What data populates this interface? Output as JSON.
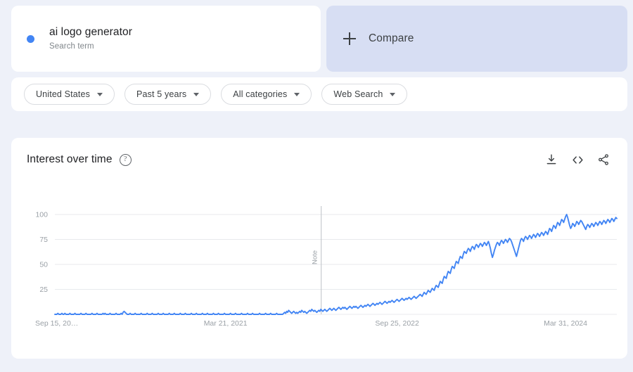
{
  "search_term": {
    "label": "ai logo generator",
    "type": "Search term",
    "color": "#4285f4"
  },
  "compare": {
    "label": "Compare",
    "icon": "plus-icon"
  },
  "filters": [
    {
      "label": "United States"
    },
    {
      "label": "Past 5 years"
    },
    {
      "label": "All categories"
    },
    {
      "label": "Web Search"
    }
  ],
  "chart_panel": {
    "title": "Interest over time",
    "help_glyph": "?",
    "actions": [
      {
        "name": "download-icon"
      },
      {
        "name": "embed-icon"
      },
      {
        "name": "share-icon"
      }
    ]
  },
  "chart_data": {
    "type": "line",
    "title": "Interest over time",
    "xlabel": "",
    "ylabel": "",
    "ylim": [
      0,
      100
    ],
    "yticks": [
      25,
      50,
      75,
      100
    ],
    "grid": true,
    "legend_position": "none",
    "line_color": "#4285f4",
    "x_tick_labels": [
      "Sep 15, 20…",
      "Mar 21, 2021",
      "Sep 25, 2022",
      "Mar 31, 2024"
    ],
    "x_tick_positions": [
      0,
      0.3,
      0.605,
      0.905
    ],
    "annotations": [
      {
        "label": "Note",
        "x_fraction": 0.474,
        "orientation": "vertical"
      }
    ],
    "series": [
      {
        "name": "ai logo generator",
        "values": [
          0,
          0,
          0,
          1,
          0,
          0,
          0,
          1,
          0,
          0,
          1,
          0,
          0,
          0,
          0,
          1,
          0,
          0,
          0,
          0,
          1,
          0,
          0,
          0,
          0,
          0,
          1,
          0,
          0,
          0,
          0,
          1,
          0,
          0,
          0,
          0,
          0,
          1,
          0,
          0,
          0,
          0,
          1,
          0,
          0,
          0,
          0,
          0,
          1,
          0,
          1,
          0,
          0,
          0,
          0,
          1,
          0,
          0,
          0,
          0,
          0,
          1,
          0,
          0,
          0,
          0,
          1,
          0,
          2,
          3,
          2,
          1,
          0,
          0,
          0,
          1,
          0,
          0,
          0,
          0,
          1,
          0,
          0,
          0,
          0,
          0,
          1,
          0,
          0,
          0,
          0,
          0,
          1,
          0,
          0,
          0,
          0,
          1,
          0,
          0,
          0,
          0,
          0,
          1,
          0,
          0,
          0,
          0,
          1,
          0,
          0,
          0,
          0,
          0,
          1,
          0,
          0,
          0,
          0,
          1,
          0,
          0,
          0,
          0,
          0,
          1,
          0,
          0,
          0,
          0,
          1,
          0,
          0,
          0,
          0,
          0,
          1,
          0,
          0,
          0,
          0,
          1,
          0,
          0,
          0,
          0,
          0,
          1,
          0,
          0,
          0,
          0,
          1,
          0,
          0,
          0,
          0,
          0,
          1,
          0,
          0,
          0,
          0,
          1,
          0,
          0,
          0,
          0,
          0,
          1,
          0,
          0,
          0,
          0,
          0,
          1,
          0,
          0,
          0,
          0,
          1,
          0,
          0,
          0,
          0,
          0,
          1,
          0,
          0,
          0,
          0,
          0,
          1,
          0,
          0,
          0,
          0,
          1,
          0,
          0,
          0,
          0,
          0,
          0,
          1,
          0,
          0,
          0,
          0,
          0,
          1,
          0,
          0,
          0,
          0,
          1,
          0,
          0,
          0,
          0,
          0,
          1,
          0,
          0,
          0,
          0,
          0,
          0,
          1,
          2,
          1,
          3,
          2,
          4,
          3,
          2,
          1,
          2,
          3,
          2,
          1,
          2,
          1,
          2,
          3,
          2,
          4,
          3,
          2,
          3,
          2,
          1,
          2,
          3,
          4,
          3,
          5,
          4,
          3,
          4,
          3,
          2,
          3,
          4,
          3,
          5,
          4,
          3,
          4,
          5,
          4,
          3,
          4,
          5,
          6,
          5,
          4,
          5,
          6,
          5,
          4,
          5,
          6,
          7,
          6,
          5,
          6,
          7,
          6,
          7,
          6,
          5,
          6,
          7,
          8,
          7,
          6,
          7,
          8,
          7,
          8,
          7,
          6,
          7,
          8,
          9,
          8,
          7,
          8,
          9,
          8,
          9,
          10,
          9,
          8,
          9,
          10,
          11,
          10,
          9,
          10,
          11,
          10,
          11,
          12,
          11,
          10,
          11,
          12,
          13,
          12,
          11,
          12,
          13,
          12,
          13,
          14,
          13,
          12,
          13,
          14,
          15,
          14,
          13,
          14,
          15,
          16,
          15,
          14,
          15,
          16,
          15,
          16,
          17,
          16,
          15,
          16,
          17,
          18,
          17,
          16,
          17,
          18,
          19,
          20,
          19,
          18,
          20,
          22,
          21,
          20,
          22,
          24,
          23,
          22,
          24,
          26,
          25,
          24,
          27,
          29,
          28,
          27,
          30,
          33,
          32,
          31,
          35,
          38,
          37,
          36,
          40,
          43,
          42,
          41,
          45,
          48,
          47,
          46,
          50,
          53,
          52,
          51,
          55,
          58,
          57,
          56,
          60,
          63,
          62,
          61,
          64,
          66,
          65,
          63,
          66,
          68,
          67,
          65,
          68,
          70,
          69,
          67,
          69,
          71,
          70,
          68,
          70,
          72,
          71,
          69,
          71,
          73,
          70,
          66,
          61,
          57,
          60,
          64,
          67,
          70,
          72,
          71,
          69,
          72,
          74,
          73,
          71,
          73,
          75,
          74,
          72,
          74,
          76,
          75,
          73,
          70,
          67,
          64,
          61,
          58,
          62,
          66,
          70,
          74,
          76,
          75,
          73,
          76,
          78,
          77,
          75,
          77,
          79,
          78,
          76,
          78,
          80,
          79,
          77,
          79,
          81,
          80,
          78,
          80,
          82,
          81,
          79,
          81,
          83,
          82,
          80,
          83,
          86,
          85,
          83,
          86,
          89,
          88,
          86,
          89,
          92,
          91,
          89,
          92,
          95,
          94,
          92,
          95,
          98,
          100,
          97,
          93,
          89,
          86,
          88,
          91,
          90,
          88,
          90,
          93,
          92,
          90,
          92,
          94,
          93,
          91,
          89,
          87,
          85,
          88,
          90,
          89,
          87,
          89,
          91,
          90,
          88,
          90,
          92,
          91,
          89,
          91,
          93,
          92,
          90,
          92,
          94,
          93,
          91,
          93,
          95,
          94,
          92,
          94,
          96,
          95,
          93,
          95,
          97,
          96
        ]
      }
    ]
  }
}
